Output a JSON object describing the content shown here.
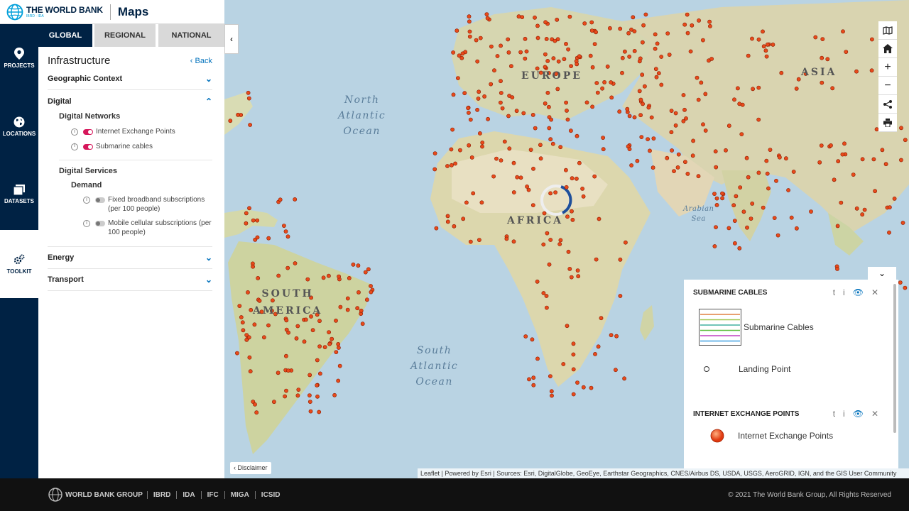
{
  "header": {
    "logo_title": "THE WORLD BANK",
    "logo_sub": "IBRD · IDA",
    "app_name": "Maps"
  },
  "nav": [
    {
      "label": "PROJECTS",
      "icon": "map-pin-icon"
    },
    {
      "label": "LOCATIONS",
      "icon": "globe-icon"
    },
    {
      "label": "DATASETS",
      "icon": "datasets-icon"
    },
    {
      "label": "TOOLKIT",
      "icon": "gears-icon"
    }
  ],
  "tabs": [
    "GLOBAL",
    "REGIONAL",
    "NATIONAL"
  ],
  "panel": {
    "title": "Infrastructure",
    "back": "Back",
    "sections": {
      "geo": "Geographic Context",
      "digital": "Digital",
      "digital_networks": "Digital Networks",
      "ixp": "Internet Exchange Points",
      "cables": "Submarine cables",
      "digital_services": "Digital Services",
      "demand": "Demand",
      "broadband": "Fixed broadband subscriptions (per 100 people)",
      "mobile": "Mobile cellular subscriptions (per 100 people)",
      "energy": "Energy",
      "transport": "Transport"
    }
  },
  "map": {
    "labels": {
      "north_atlantic": [
        "North",
        "Atlantic",
        "Ocean"
      ],
      "south_atlantic": [
        "South",
        "Atlantic",
        "Ocean"
      ],
      "arabian_sea": [
        "Arabian",
        "Sea"
      ],
      "africa": "AFRICA",
      "europe": "EUROPE",
      "asia": "ASIA",
      "south_america": [
        "SOUTH",
        "AMERICA"
      ]
    },
    "disclaimer": "Disclaimer",
    "attribution": "Leaflet | Powered by Esri | Sources: Esri, DigitalGlobe, GeoEye, Earthstar Geographics, CNES/Airbus DS, USDA, USGS, AeroGRID, IGN, and the GIS User Community"
  },
  "legend": {
    "submarine": {
      "title": "SUBMARINE CABLES",
      "cables_label": "Submarine Cables",
      "landing_label": "Landing Point"
    },
    "ixp": {
      "title": "INTERNET EXCHANGE POINTS",
      "label": "Internet Exchange Points"
    },
    "cable_colors": [
      "#e08040",
      "#a0c850",
      "#40b0a0",
      "#60c040",
      "#c040c0",
      "#40a0e0"
    ],
    "ixp_color": "#e84a1a"
  },
  "footer": {
    "logo": "WORLD BANK GROUP",
    "links": [
      "IBRD",
      "IDA",
      "IFC",
      "MIGA",
      "ICSID"
    ],
    "copyright": "© 2021 The World Bank Group, All Rights Reserved"
  }
}
